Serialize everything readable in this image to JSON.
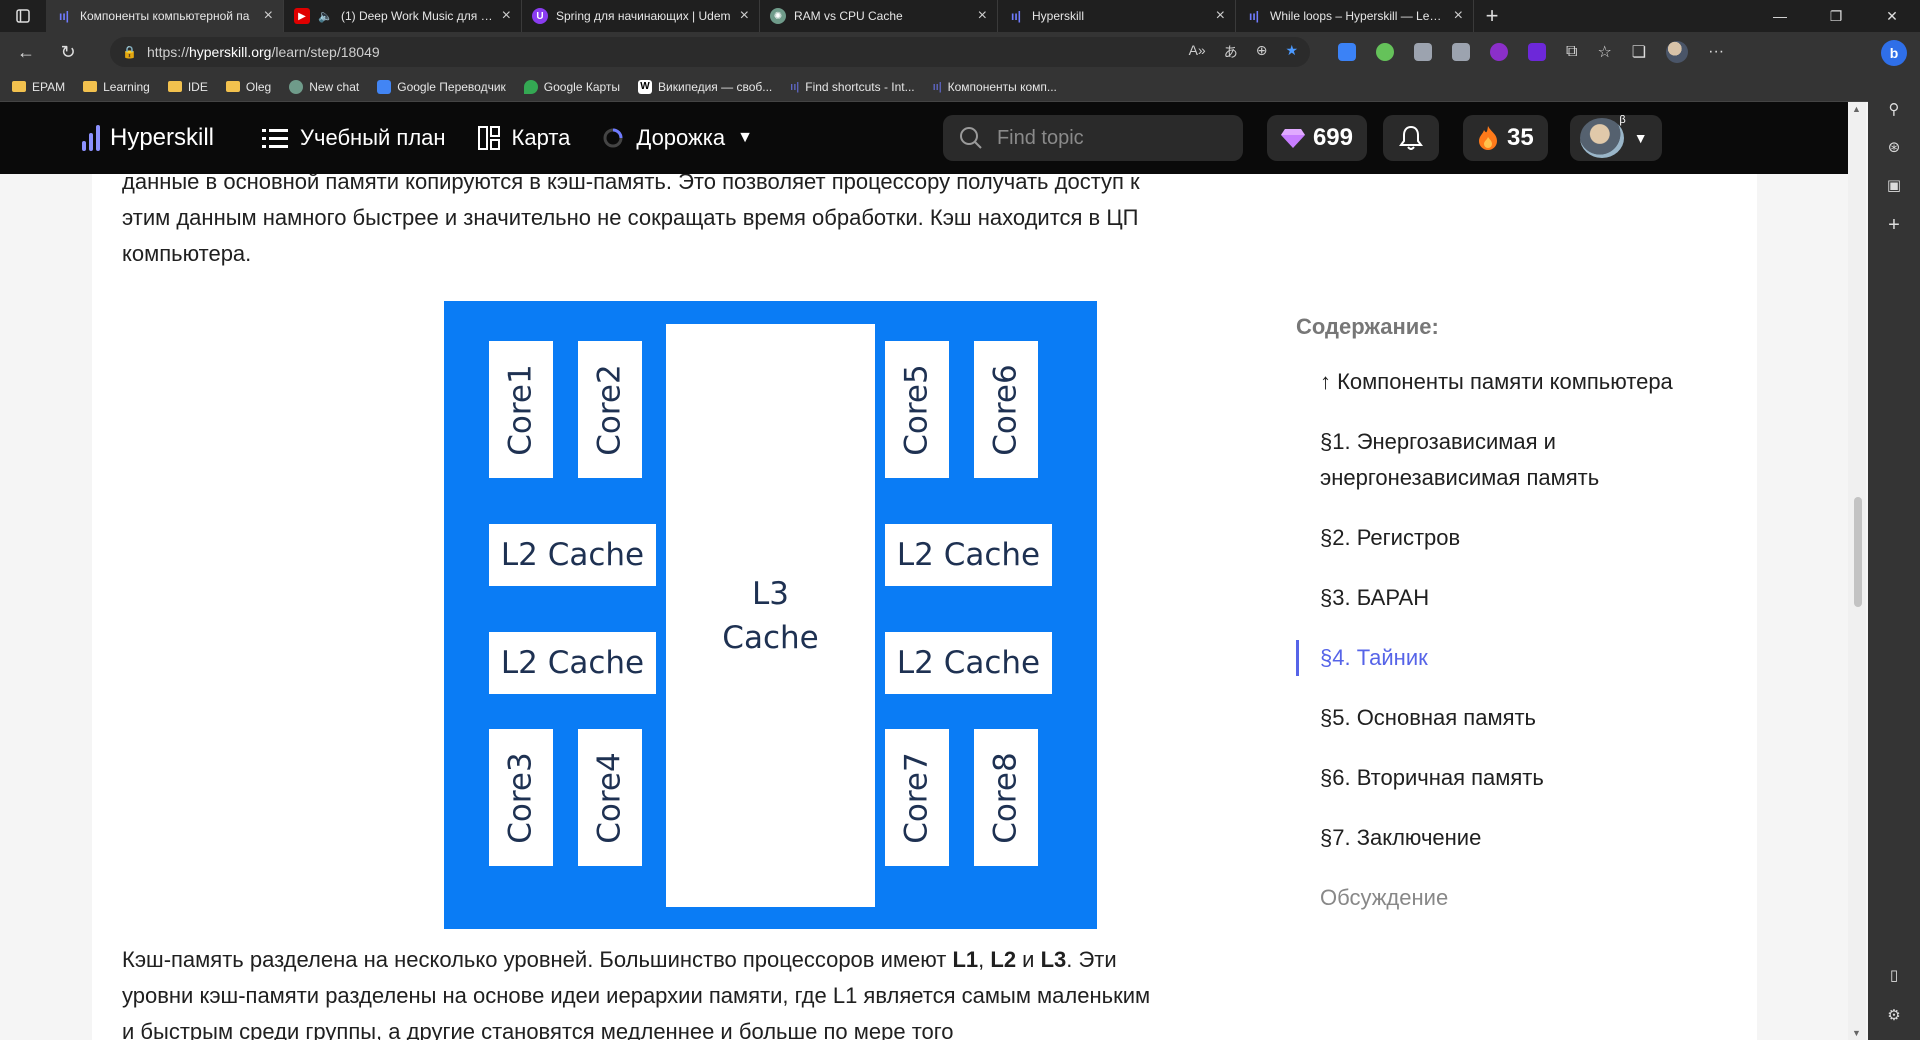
{
  "browser": {
    "tabs": [
      {
        "label": "Компоненты компьютерной па",
        "favicon": "hyperskill",
        "active": true
      },
      {
        "label": "(1) Deep Work Music для пр",
        "favicon": "youtube",
        "audio": true
      },
      {
        "label": "Spring для начинающих | Udem",
        "favicon": "udemy"
      },
      {
        "label": "RAM vs CPU Cache",
        "favicon": "chatgpt"
      },
      {
        "label": "Hyperskill",
        "favicon": "hyperskill"
      },
      {
        "label": "While loops – Hyperskill — Learn",
        "favicon": "hyperskill"
      }
    ],
    "url_prefix": "https://",
    "url_host": "hyperskill.org",
    "url_path": "/learn/step/18049",
    "bookmarks": [
      {
        "label": "EPAM",
        "icon": "folder"
      },
      {
        "label": "Learning",
        "icon": "folder"
      },
      {
        "label": "IDE",
        "icon": "folder"
      },
      {
        "label": "Oleg",
        "icon": "folder"
      },
      {
        "label": "New chat",
        "icon": "chatgpt"
      },
      {
        "label": "Google Переводчик",
        "icon": "translate"
      },
      {
        "label": "Google Карты",
        "icon": "maps"
      },
      {
        "label": "Википедия — своб...",
        "icon": "wikipedia"
      },
      {
        "label": "Find shortcuts - Int...",
        "icon": "hyperskill"
      },
      {
        "label": "Компоненты комп...",
        "icon": "hyperskill"
      }
    ]
  },
  "header": {
    "logo": "Hyperskill",
    "nav": [
      {
        "label": "Учебный план",
        "icon": "list-icon"
      },
      {
        "label": "Карта",
        "icon": "map-icon"
      },
      {
        "label": "Дорожка",
        "icon": "progress-ring-icon"
      }
    ],
    "search_placeholder": "Find topic",
    "gems": "699",
    "streak": "35",
    "user_badge": "β"
  },
  "article": {
    "top_paragraph": "данные в основной памяти копируются в кэш-память. Это позволяет процессору получать доступ к этим данным намного быстрее и значительно не сокращать время обработки. Кэш находится в ЦП компьютера.",
    "bottom_intro": "Кэш-память разделена на несколько уровней. Большинство процессоров имеют ",
    "l1": "L1",
    "comma": ", ",
    "l2": "L2",
    "and": " и ",
    "l3": "L3",
    "bottom_rest": ". Эти уровни кэш-памяти разделены на основе идеи иерархии памяти, где L1 является самым маленьким и быстрым среди группы, а другие становятся медленнее и больше по мере того"
  },
  "diagram": {
    "cores": [
      "Core1",
      "Core2",
      "Core3",
      "Core4",
      "Core5",
      "Core6",
      "Core7",
      "Core8"
    ],
    "l2_label": "L2 Cache",
    "l3_line1": "L3",
    "l3_line2": "Cache",
    "background_color": "#0a7cf5"
  },
  "toc": {
    "title": "Содержание:",
    "items": [
      {
        "label": "↑ Компоненты памяти компьютера",
        "state": "normal"
      },
      {
        "label": "§1. Энергозависимая и энергонезависимая память",
        "state": "normal"
      },
      {
        "label": "§2. Регистров",
        "state": "normal"
      },
      {
        "label": "§3. БАРАН",
        "state": "normal"
      },
      {
        "label": "§4. Тайник",
        "state": "active"
      },
      {
        "label": "§5. Основная память",
        "state": "normal"
      },
      {
        "label": "§6. Вторичная память",
        "state": "normal"
      },
      {
        "label": "§7. Заключение",
        "state": "normal"
      },
      {
        "label": "Обсуждение",
        "state": "muted"
      }
    ]
  }
}
